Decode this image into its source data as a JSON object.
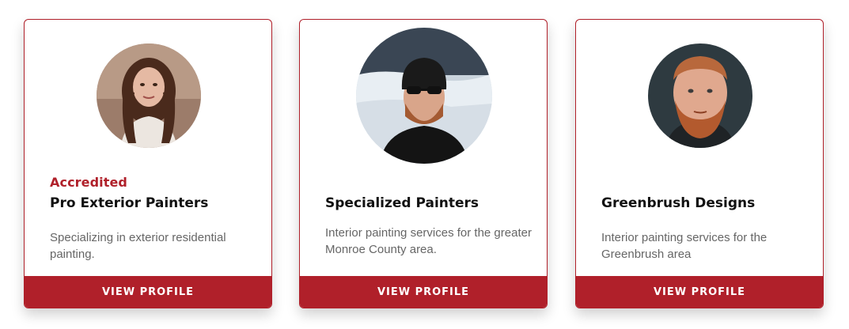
{
  "cards": [
    {
      "badge": "Accredited",
      "name": "Pro Exterior Painters",
      "description": "Specializing in exterior residential painting.",
      "button_label": "VIEW PROFILE"
    },
    {
      "badge": "",
      "name": "Specialized Painters",
      "description": "Interior painting services for the greater Monroe County area.",
      "button_label": "VIEW PROFILE"
    },
    {
      "badge": "",
      "name": "Greenbrush Designs",
      "description": "Interior painting services for the Greenbrush area",
      "button_label": "VIEW PROFILE"
    }
  ],
  "colors": {
    "accent": "#b0202a",
    "title": "#111111",
    "body_text": "#666666"
  }
}
